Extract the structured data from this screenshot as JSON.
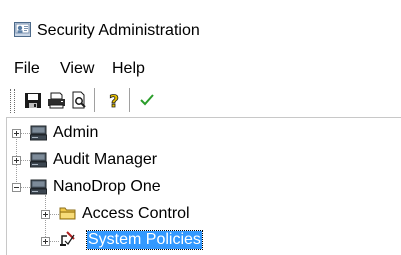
{
  "window": {
    "title": "Security Administration"
  },
  "menubar": {
    "items": [
      {
        "label": "File"
      },
      {
        "label": "View"
      },
      {
        "label": "Help"
      }
    ]
  },
  "toolbar": {
    "buttons": [
      {
        "icon": "save-icon"
      },
      {
        "icon": "print-icon"
      },
      {
        "icon": "print-preview-icon"
      },
      {
        "icon": "help-icon"
      },
      {
        "icon": "checkmark-icon"
      }
    ]
  },
  "tree": {
    "nodes": [
      {
        "label": "Admin",
        "icon": "computer-icon",
        "expander": "plus"
      },
      {
        "label": "Audit Manager",
        "icon": "computer-icon",
        "expander": "plus"
      },
      {
        "label": "NanoDrop One",
        "icon": "computer-icon",
        "expander": "minus"
      },
      {
        "label": "Access Control",
        "icon": "folder-icon",
        "expander": "plus"
      },
      {
        "label": "System Policies",
        "icon": "policy-icon",
        "expander": "plus",
        "selected": true
      }
    ]
  },
  "colors": {
    "selection": "#3399ff",
    "checkmark": "#2a9d2a",
    "folder": "#f2c94c"
  }
}
